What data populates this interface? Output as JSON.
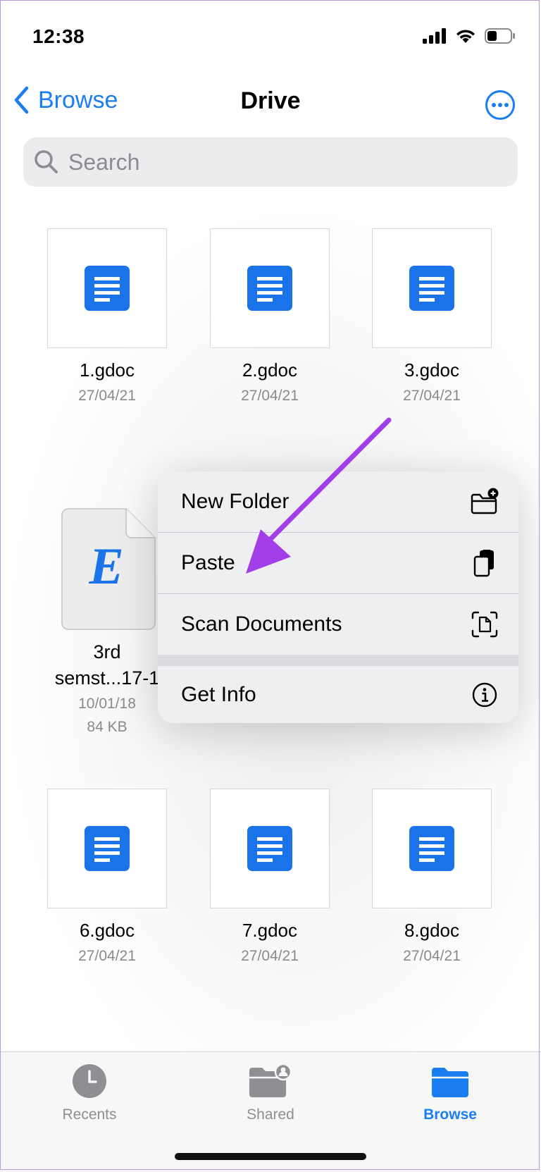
{
  "status_bar": {
    "time": "12:38"
  },
  "nav": {
    "back_label": "Browse",
    "title": "Drive"
  },
  "search": {
    "placeholder": "Search"
  },
  "files": [
    {
      "name": "1.gdoc",
      "date": "27/04/21"
    },
    {
      "name": "2.gdoc",
      "date": "27/04/21"
    },
    {
      "name": "3.gdoc",
      "date": "27/04/21"
    },
    {
      "name_line1": "3rd",
      "name_line2": "semst...17-1",
      "date": "10/01/18",
      "size": "84 KB",
      "icon_letter": "E"
    },
    {
      "name": "6.gdoc",
      "date": "27/04/21"
    },
    {
      "name": "7.gdoc",
      "date": "27/04/21"
    },
    {
      "name": "8.gdoc",
      "date": "27/04/21"
    }
  ],
  "context_menu": {
    "items": [
      {
        "label": "New Folder",
        "icon": "new-folder-icon"
      },
      {
        "label": "Paste",
        "icon": "paste-icon"
      },
      {
        "label": "Scan Documents",
        "icon": "scan-documents-icon"
      },
      {
        "label": "Get Info",
        "icon": "info-icon"
      }
    ]
  },
  "tab_bar": {
    "tabs": [
      {
        "label": "Recents",
        "icon": "clock-icon"
      },
      {
        "label": "Shared",
        "icon": "shared-folder-icon"
      },
      {
        "label": "Browse",
        "icon": "folder-icon",
        "active": true
      }
    ]
  },
  "colors": {
    "accent": "#1a7ef2",
    "gdoc_blue": "#1a73e8",
    "annotation_arrow": "#a23ee8"
  }
}
